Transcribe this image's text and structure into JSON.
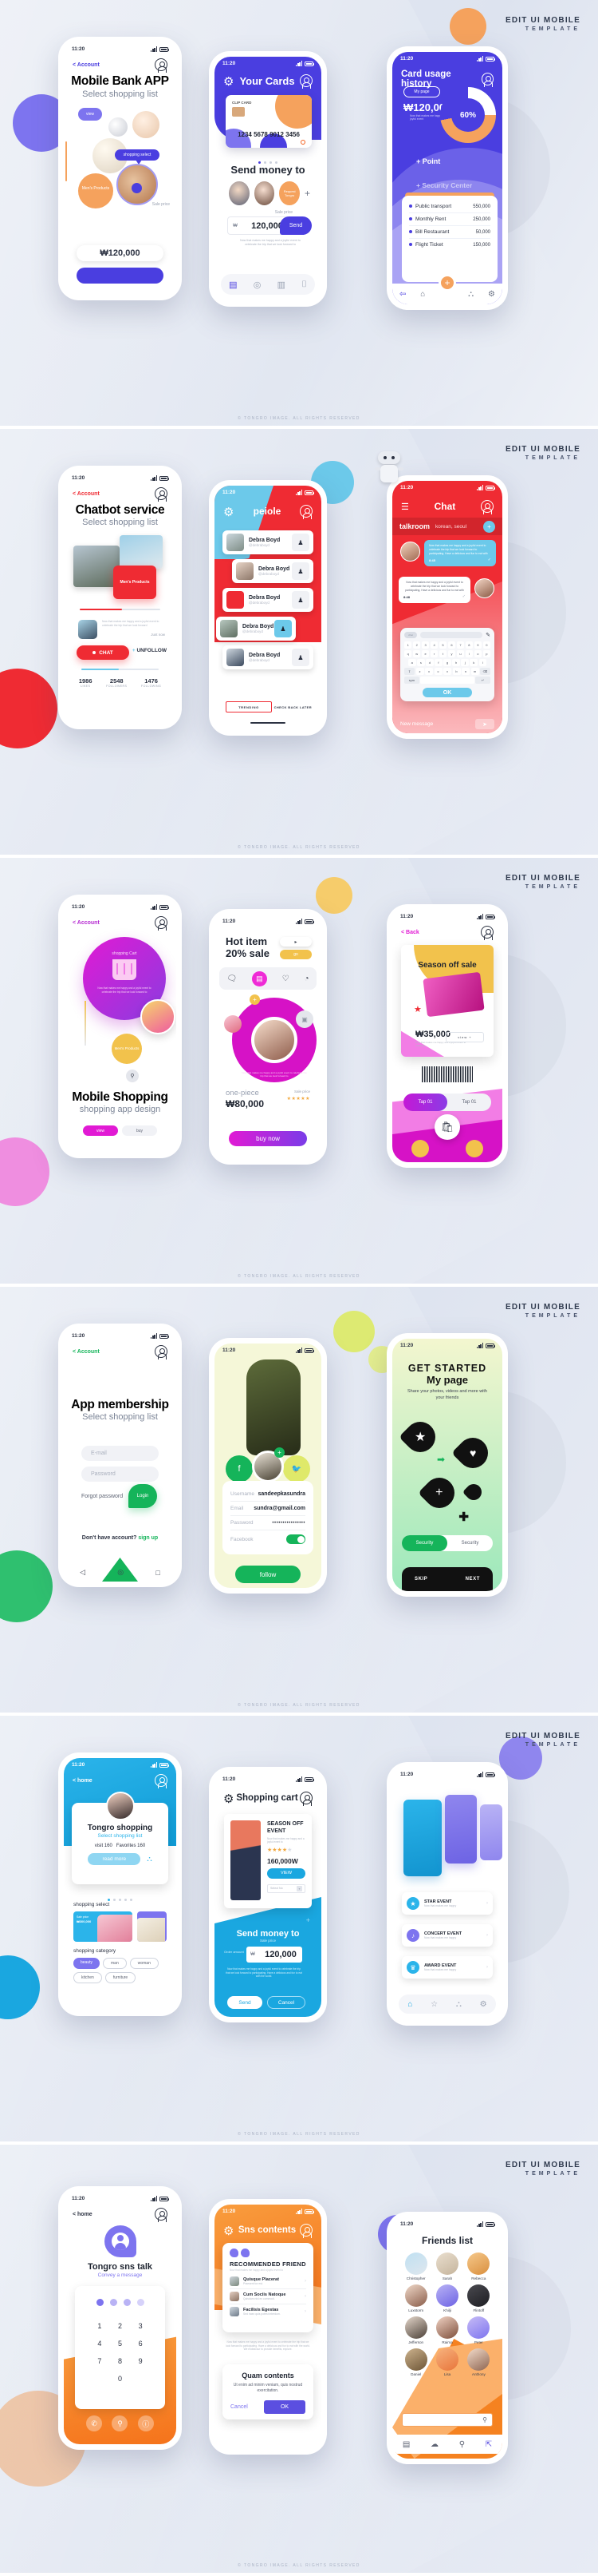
{
  "brand": {
    "line1": "EDIT UI MOBILE",
    "line2": "TEMPLATE"
  },
  "footnote": "© TONGRO IMAGE. ALL RIGHTS RESERVED",
  "status_bar": {
    "time": "11:20",
    "signal_icon": "signal-bars-icon",
    "battery_icon": "battery-icon"
  },
  "colors": {
    "indigo": "#4a3ee0",
    "indigo_light": "#7d74ef",
    "orange": "#f5a25d",
    "red": "#ef2b33",
    "sky": "#4ec8ee",
    "magenta": "#d916c9",
    "green": "#15b45a",
    "blue": "#1aa7e0",
    "orange2": "#f58220",
    "violet": "#6c63e0"
  },
  "panel1": {
    "phone1": {
      "back": "< Account",
      "avatar_icon": "account-icon",
      "title": "Mobile Bank APP",
      "subtitle": "Select shopping list",
      "chip_view": "view",
      "chip_select": "shopping select",
      "chip_mens": "Men's Products",
      "chip_sale": "Sale price",
      "amount": "₩120,000"
    },
    "phone2": {
      "gear_icon": "gear-icon",
      "title": "Your Cards",
      "avatar_icon": "account-icon",
      "card_label": "CLIP CARD",
      "card_number": "1234 5678 9012 3456",
      "dots": 4,
      "send_title": "Send money to",
      "contact_add": "Request Tongro",
      "plus": "+",
      "amount_label": "Sale price",
      "currency": "₩",
      "amount": "120,000",
      "send_button": "Send",
      "note": "Now that makes me happy and a joyful event to celebrate the trip that we look forward to",
      "tabs": [
        "wallet-icon",
        "coin-icon",
        "card-icon",
        "lock-icon"
      ]
    },
    "phone3": {
      "title": "Card usage history",
      "avatar_icon": "account-icon",
      "mypage": "My page",
      "amount": "₩120,000",
      "note": "Now that makes me happy and a joyful event",
      "donut_value": "60%",
      "point": "+ Point",
      "security": "+ Security Center",
      "rows": [
        {
          "label": "Public transport",
          "value": "550,000"
        },
        {
          "label": "Monthly Rent",
          "value": "250,000"
        },
        {
          "label": "Bill Restaurant",
          "value": "50,000"
        },
        {
          "label": "Flight Ticket",
          "value": "150,000"
        }
      ],
      "fab": "+",
      "tabs": [
        "back-icon",
        "home-icon",
        "share-icon",
        "gear-icon"
      ]
    }
  },
  "panel2": {
    "phone1": {
      "back": "< Account",
      "title": "Chatbot service",
      "subtitle": "Select shopping list",
      "card_label": "Men's Products",
      "note": "Now that makes me happy and a joyful event to celebrate the trip that we look forward",
      "timestamp": "Just now",
      "chat_button": "CHAT",
      "unfollow_button": "UNFOLLOW",
      "stats": [
        {
          "value": "1986",
          "label": "LIKES"
        },
        {
          "value": "2548",
          "label": "FOLLOWERS"
        },
        {
          "value": "1476",
          "label": "FOLLOWING"
        }
      ]
    },
    "phone2": {
      "gear_icon": "gear-icon",
      "title": "peiole",
      "avatar_icon": "account-icon",
      "contacts": [
        {
          "name": "Debra Boyd",
          "handle": "@debraboyd"
        },
        {
          "name": "Debra Boyd",
          "handle": "@debraboyd"
        },
        {
          "name": "Debra Boyd",
          "handle": "@debraboyd"
        },
        {
          "name": "Debra Boyd",
          "handle": "@debraboyd"
        },
        {
          "name": "Debra Boyd",
          "handle": "@debraboyd"
        }
      ],
      "tab_active": "TRENDING",
      "tab_inactive": "CHECK BACK LATER"
    },
    "phone3": {
      "menu_icon": "hamburger-icon",
      "title": "Chat",
      "avatar_icon": "account-icon",
      "room": "talkroom",
      "room_sub": "korean, seoul",
      "add_icon": "plus-circle-icon",
      "msg_in": "Now that makes me happy and a joyful event to celebrate the trip that we look forward to participating. Have a delicious and fun to eat with",
      "msg_in_time": "8:45",
      "msg_out": "Now that makes me happy and a joyful event to celebrate the trip that we look forward to participating. Have a delicious and fun to eat with",
      "msg_out_time": "8:48",
      "keyboard_rows": [
        "1234567890",
        "qwertyuiop",
        "asdfghjkl",
        "zxcvbnm"
      ],
      "sym_key": "sym",
      "ok_button": "OK",
      "input_placeholder": "New message",
      "send_icon": "send-icon"
    }
  },
  "panel3": {
    "phone1": {
      "back": "< Account",
      "bubble_title": "shopping Cart",
      "basket_icon": "basket-icon",
      "bubble_note": "Now that makes me happy and a joyful event to celebrate the trip that we look forward to",
      "chip_mens": "Men's Products",
      "search_icon": "search-icon",
      "title": "Mobile Shopping",
      "subtitle": "shopping app design",
      "btn_view": "view",
      "btn_buy": "buy"
    },
    "phone2": {
      "title_l1": "Hot item",
      "title_l2": "20% sale",
      "play_icon": "play-icon",
      "go_button": "go",
      "tabs": [
        "chat-icon",
        "basket-icon",
        "heart-icon",
        "support-24-icon"
      ],
      "plus": "+",
      "note": "Now that makes me happy and a joyful event to celebrate the trip that we look forward to",
      "product": "one-piece",
      "price": "₩80,000",
      "price_label": "Sale price",
      "stars": "★★★★★",
      "buy_button": "buy now"
    },
    "phone3": {
      "back": "< Back",
      "banner_title": "Season off sale",
      "price": "₩35,000",
      "note": "Now that makes me happy and a joyful event to celebrate",
      "view_button": "view +",
      "barcode_icon": "barcode-icon",
      "tab_active": "Tap 01",
      "tab_inactive": "Tap 01",
      "bag_icon": "shopping-bag-icon"
    }
  },
  "panel4": {
    "phone1": {
      "back": "< Account",
      "title": "App membership",
      "subtitle": "Select shopping list",
      "email_placeholder": "E-mail",
      "password_placeholder": "Password",
      "forgot": "Forgot password",
      "login_button": "Login",
      "signup_prompt": "Don't have account?",
      "signup_link": "sign up",
      "nav": [
        "back-triangle-icon",
        "home-circle-icon",
        "recents-square-icon"
      ]
    },
    "phone2": {
      "facebook_icon": "facebook-icon",
      "twitter_icon": "twitter-icon",
      "plus_icon": "plus-icon",
      "fields": [
        {
          "label": "Username",
          "value": "sandeepkasundra"
        },
        {
          "label": "Email",
          "value": "sundra@gmail.com"
        },
        {
          "label": "Password",
          "value": "••••••••••••••••"
        },
        {
          "label": "Facebook",
          "value": ""
        }
      ],
      "toggle_on": true,
      "follow_button": "follow"
    },
    "phone3": {
      "title_l1": "GET STARTED",
      "title_l2": "My page",
      "subtitle": "Share your photos, videos and more with your friends",
      "icons": [
        "star-pin-icon",
        "heart-pin-icon",
        "plus-pin-icon",
        "location-pin-icon",
        "arrow-right-icon",
        "plus-icon"
      ],
      "tab_active": "Security",
      "tab_inactive": "Security",
      "skip": "SKIP",
      "next": "NEXT"
    }
  },
  "panel5": {
    "phone1": {
      "back": "< home",
      "title": "Tongro shopping",
      "subtitle": "Select shopping list",
      "visit": "visit 160",
      "favorites": "Favorites 160",
      "read_more": "read more",
      "share_icon": "share-icon",
      "dots": 5,
      "section1": "shopping select",
      "card1_label": "Sale price",
      "card1_price": "₩300,000",
      "section2": "shopping category",
      "categories": [
        "beauty",
        "man",
        "woman",
        "kitchen",
        "furniture"
      ]
    },
    "phone2": {
      "gear_icon": "gear-icon",
      "title": "Shopping cart",
      "avatar_icon": "account-icon",
      "product_title": "SEASON OFF EVENT",
      "product_note": "Now that makes me happy and a joyful event to",
      "stars_filled": 4,
      "stars_total": 5,
      "price": "160,000W",
      "view_button": "VIEW",
      "select_placeholder": "Select No",
      "send_title": "Send money to",
      "send_sub": "Sale price",
      "order_label": "Order amount",
      "currency": "₩",
      "amount": "120,000",
      "note": "Now that makes me happy and a joyful event to celebrate the trip that we look forward to participating. Have a delicious and fun to eat with the world.",
      "btn_send": "Send",
      "btn_cancel": "Cancel"
    },
    "phone3": {
      "cards": [
        {
          "title": "STAR EVENT",
          "sub": "Now that makes me happy"
        },
        {
          "title": "CONCERT EVENT",
          "sub": "Now that makes me happy"
        },
        {
          "title": "AWARD EVENT",
          "sub": "Now that makes me happy"
        }
      ],
      "tabs": [
        "home-icon",
        "star-icon",
        "share-icon",
        "gear-icon"
      ]
    }
  },
  "panel6": {
    "phone1": {
      "back": "< home",
      "logo_icon": "profile-pin-icon",
      "title": "Tongro sns talk",
      "subtitle": "Convey a message",
      "pin_dots": 4,
      "keys": [
        "1",
        "2",
        "3",
        "4",
        "5",
        "6",
        "7",
        "8",
        "9",
        "0"
      ],
      "tabs": [
        "phone-icon",
        "search-icon",
        "info-icon"
      ]
    },
    "phone2": {
      "gear_icon": "gear-icon",
      "title": "Sns contents",
      "avatar_icon": "account-icon",
      "card_title": "RECOMMENDED FRIEND",
      "card_note": "Now that makes me happy and a joyful event to",
      "friends": [
        {
          "name": "Quisque Placerat",
          "desc": "Praesent tor est."
        },
        {
          "name": "Cum Sociis Natoque",
          "desc": "Quisdam nisi ex commodi."
        },
        {
          "name": "Facilisis Egestas",
          "desc": "Sed haec quis potest interdum."
        }
      ],
      "body_note": "Now that makes me happy and a joyful event to celebrate the trip that we look forward to participating. Have a delicious and fun to eat with the world. We endeavour to provide benefits, explore.",
      "dialog_title": "Quam contents",
      "dialog_body": "Ut enim ad minim veniam, quis nostrud exercitation.",
      "cancel": "Cancel",
      "ok": "OK"
    },
    "phone3": {
      "title": "Friends list",
      "friends": [
        "Christopher",
        "Sarah",
        "Rebecca",
        "Luxstorm",
        "Khilji",
        "Flintoff",
        "Jefferson",
        "Raima",
        "Peter",
        "Daniel",
        "Lisa",
        "Anthony"
      ],
      "search_icon": "search-icon",
      "tabs": [
        "wallet-icon",
        "cloud-icon",
        "search-circle-icon",
        "export-icon"
      ]
    }
  }
}
